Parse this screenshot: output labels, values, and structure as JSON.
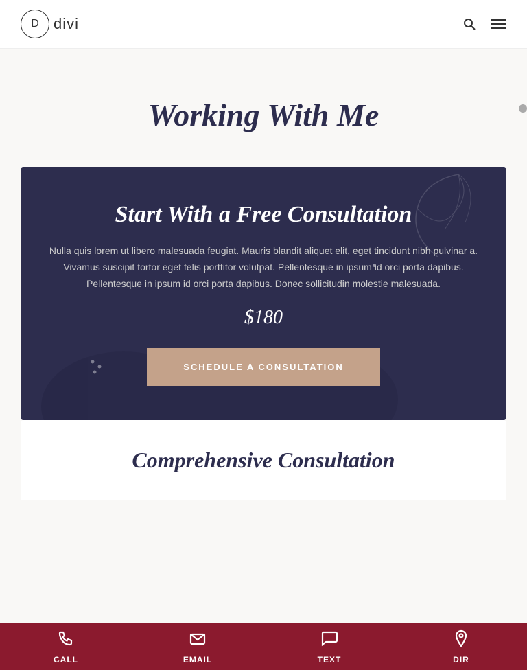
{
  "header": {
    "logo_letter": "D",
    "logo_name": "divi",
    "search_label": "search",
    "menu_label": "menu"
  },
  "page_title_section": {
    "title": "Working With Me"
  },
  "free_consultation_card": {
    "title": "Start With a Free Consultation",
    "description": "Nulla quis lorem ut libero malesuada feugiat. Mauris blandit aliquet elit, eget tincidunt nibh pulvinar a. Vivamus suscipit tortor eget felis porttitor volutpat. Pellentesque in ipsum id orci porta dapibus. Pellentesque in ipsum id orci porta dapibus. Donec sollicitudin molestie malesuada.",
    "price": "$180",
    "button_label": "SCHEDULE A CONSULTATION"
  },
  "comprehensive_card": {
    "title": "Comprehensive Consultation"
  },
  "bottom_nav": {
    "items": [
      {
        "label": "CALL",
        "icon": "phone"
      },
      {
        "label": "EMAIL",
        "icon": "email"
      },
      {
        "label": "TEXT",
        "icon": "chat"
      },
      {
        "label": "DIR",
        "icon": "location"
      }
    ]
  }
}
